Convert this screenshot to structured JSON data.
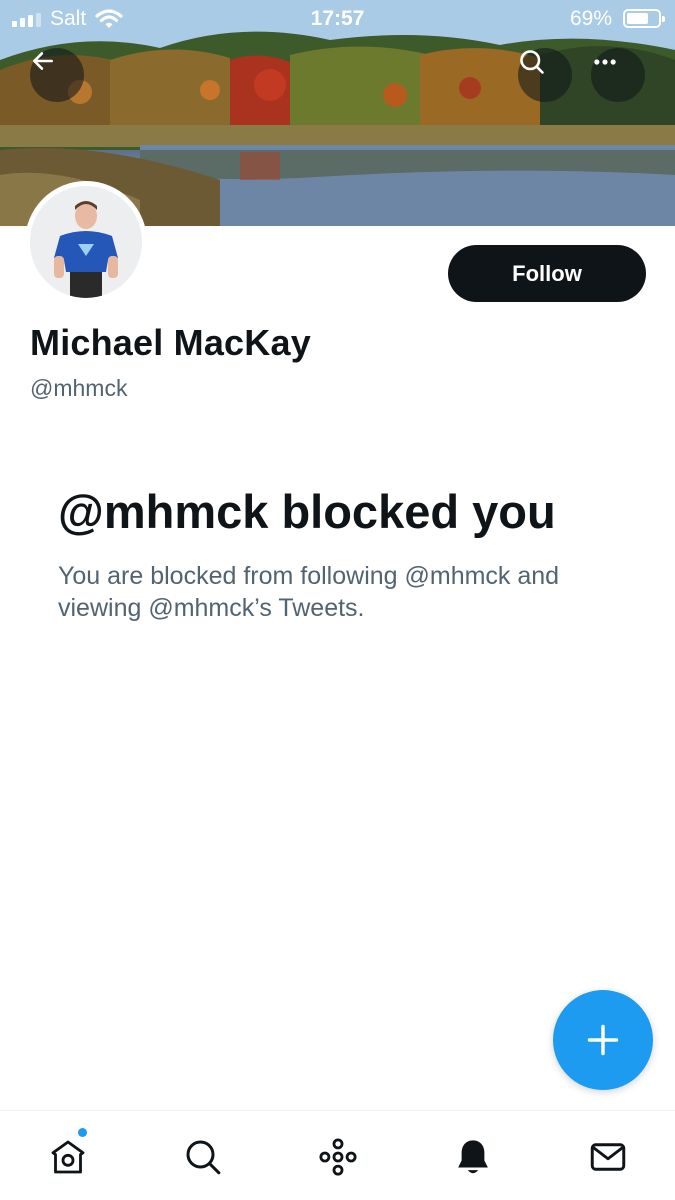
{
  "status_bar": {
    "carrier": "Salt",
    "time": "17:57",
    "battery_percent": "69%",
    "battery_level": 0.69,
    "signal_bars": 4,
    "signal_bars_active": 3
  },
  "header": {
    "back_icon": "arrow-left-icon",
    "search_icon": "search-icon",
    "more_icon": "more-horizontal-icon"
  },
  "profile": {
    "display_name": "Michael MacKay",
    "handle": "@mhmck",
    "follow_label": "Follow"
  },
  "blocked": {
    "title": "@mhmck blocked you",
    "description": "You are blocked from following @mhmck and viewing @mhmck’s Tweets."
  },
  "fab": {
    "icon": "plus-icon"
  },
  "bottom_nav": {
    "items": [
      {
        "id": "home",
        "icon": "home-icon",
        "has_badge": true
      },
      {
        "id": "search",
        "icon": "search-icon"
      },
      {
        "id": "spaces",
        "icon": "spaces-icon"
      },
      {
        "id": "notifications",
        "icon": "bell-icon",
        "active": true
      },
      {
        "id": "messages",
        "icon": "mail-icon"
      }
    ]
  },
  "colors": {
    "accent": "#1d9bf0",
    "text_primary": "#0f1419",
    "text_secondary": "#536471",
    "button_dark": "#0f1419"
  }
}
